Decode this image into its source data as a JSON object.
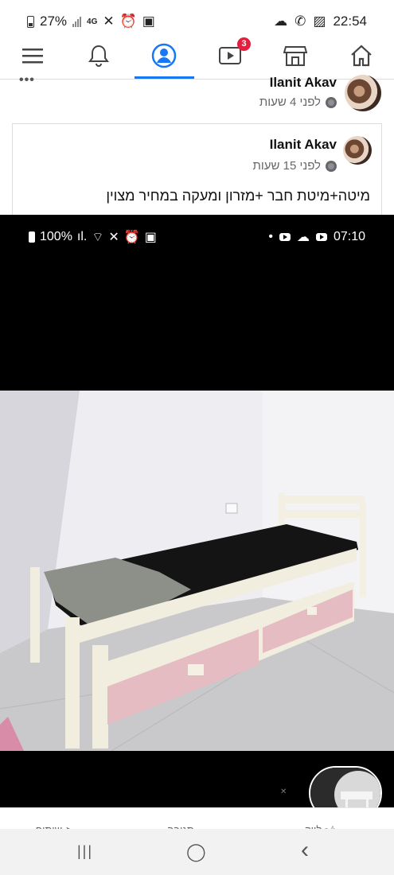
{
  "status_bar": {
    "battery": "27%",
    "network": "4G",
    "time": "22:54"
  },
  "nav": {
    "items": [
      {
        "name": "menu-icon"
      },
      {
        "name": "notifications-icon"
      },
      {
        "name": "profile-icon",
        "active": true
      },
      {
        "name": "watch-icon",
        "badge": "3"
      },
      {
        "name": "marketplace-icon"
      },
      {
        "name": "home-icon"
      }
    ],
    "accent_color": "#1877f2",
    "badge_color": "#e41e3f"
  },
  "post": {
    "author": "Ilanit Akav",
    "time": "לפני 4 שעות",
    "menu": "•••"
  },
  "shared_post": {
    "author": "Ilanit Akav",
    "time": "לפני 15 שעות",
    "text": "מיטה+מיטת חבר +מזרון ומעקה במחיר מצוין"
  },
  "embedded_status_bar": {
    "battery": "100%",
    "time": "07:10"
  },
  "actions": {
    "like": "לייק",
    "comment": "תגובה",
    "share": "שיתוף"
  },
  "system_nav": {
    "recent": "|||",
    "home": "◯",
    "back": "‹"
  }
}
